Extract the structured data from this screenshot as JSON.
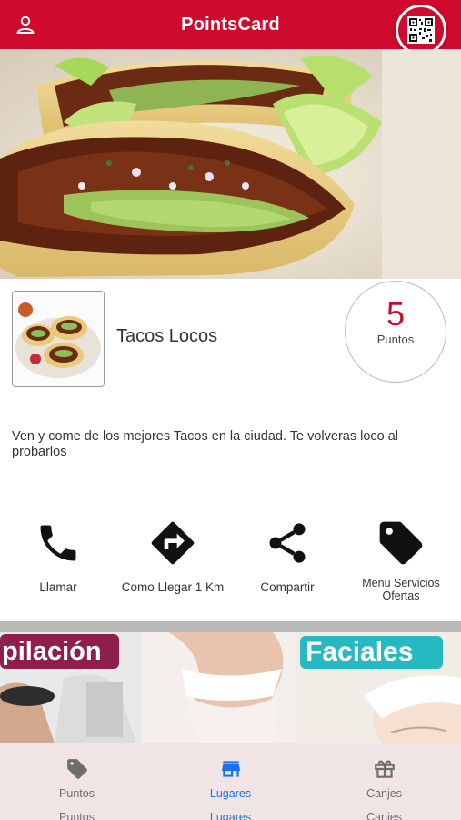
{
  "header": {
    "title": "PointsCard",
    "profile_icon": "user-icon",
    "qr_icon": "qr-code-icon",
    "bar_color": "#cf0a2c"
  },
  "store": {
    "name": "Tacos Locos",
    "points_value": "5",
    "points_label": "Puntos",
    "description": "Ven y come de los mejores Tacos en la ciudad. Te volveras loco al probarlos"
  },
  "actions": [
    {
      "label": "Llamar",
      "icon": "phone-icon"
    },
    {
      "label": "Como Llegar 1 Km",
      "icon": "directions-icon"
    },
    {
      "label": "Compartir",
      "icon": "share-icon"
    },
    {
      "label_line1": "Menu  Servicios",
      "label_line2": "Ofertas",
      "icon": "tag-icon"
    }
  ],
  "banner": {
    "left_text": "pilación",
    "right_text": "Faciales"
  },
  "tabs": [
    {
      "label": "Puntos",
      "sublabel": "Puntos",
      "icon": "tag-icon",
      "active": false
    },
    {
      "label": "Lugares",
      "sublabel": "Lugares",
      "icon": "store-icon",
      "active": true
    },
    {
      "label": "Canjes",
      "sublabel": "Canjes",
      "icon": "gift-icon",
      "active": false
    }
  ],
  "colors": {
    "accent": "#cf0a2c",
    "tab_active": "#1a73e8",
    "tab_inactive": "#6e6e6e"
  }
}
